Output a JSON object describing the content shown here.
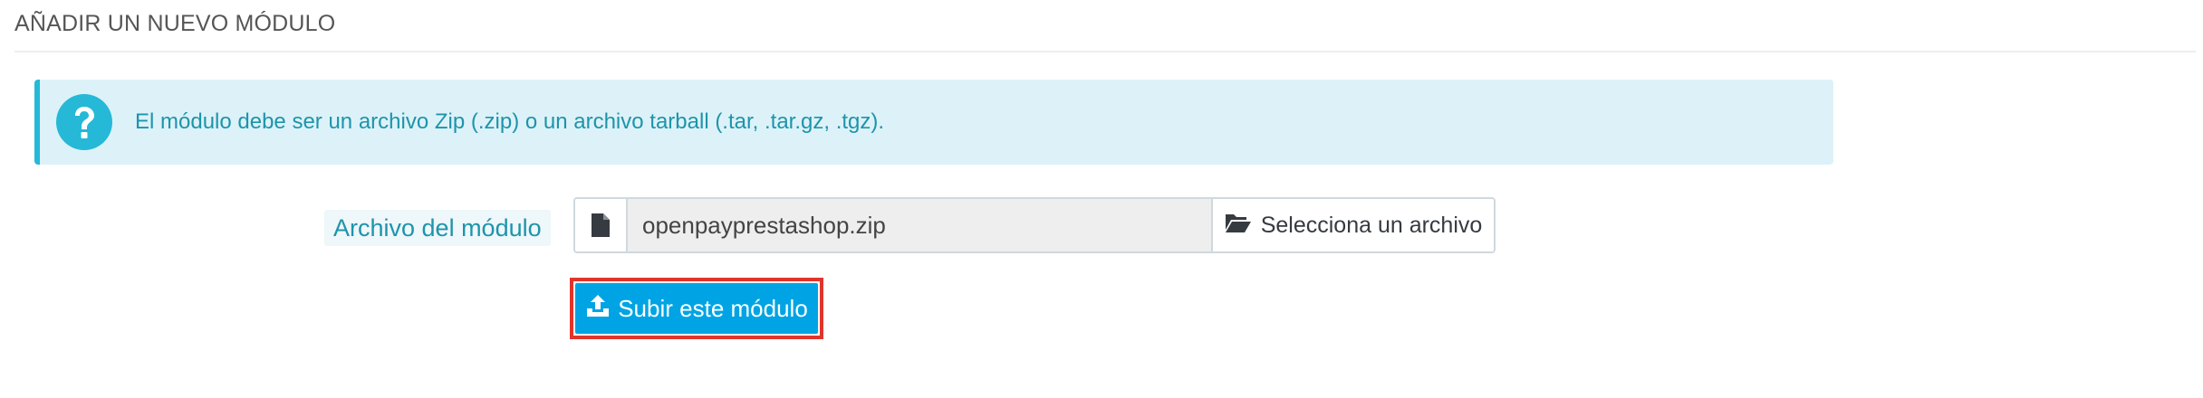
{
  "panel": {
    "title": "AÑADIR UN NUEVO MÓDULO"
  },
  "alert": {
    "icon": "question-circle-icon",
    "text": "El módulo debe ser un archivo Zip (.zip) o un archivo tarball (.tar, .tar.gz, .tgz)."
  },
  "form": {
    "file_label": "Archivo del módulo",
    "file_icon": "file-icon",
    "file_value": "openpayprestashop.zip",
    "select_icon": "folder-open-icon",
    "select_label": "Selecciona un archivo",
    "submit_icon": "upload-icon",
    "submit_label": "Subir este módulo"
  },
  "colors": {
    "accent": "#25b9d7",
    "button": "#00a4e4",
    "highlight_border": "#e0352b"
  }
}
